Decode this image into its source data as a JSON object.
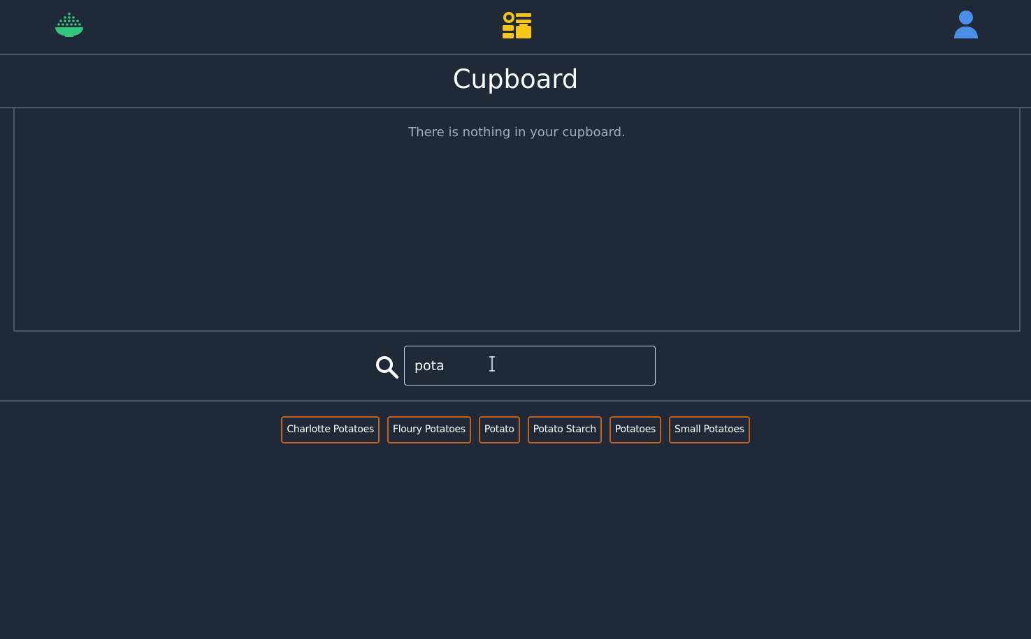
{
  "nav": {
    "home_icon": "rice-bowl-icon",
    "cupboard_icon": "cupboard-icon",
    "profile_icon": "user-icon",
    "colors": {
      "home": "#34c77b",
      "cupboard": "#f5c518",
      "profile": "#4a8fe7"
    }
  },
  "page": {
    "title": "Cupboard",
    "empty_message": "There is nothing in your cupboard."
  },
  "search": {
    "icon": "search-icon",
    "value": "pota"
  },
  "suggestions": [
    "Charlotte Potatoes",
    "Floury Potatoes",
    "Potato",
    "Potato Starch",
    "Potatoes",
    "Small Potatoes"
  ],
  "colors": {
    "background": "#1f2937",
    "divider": "#4b5563",
    "chip_border": "#c2631a"
  }
}
